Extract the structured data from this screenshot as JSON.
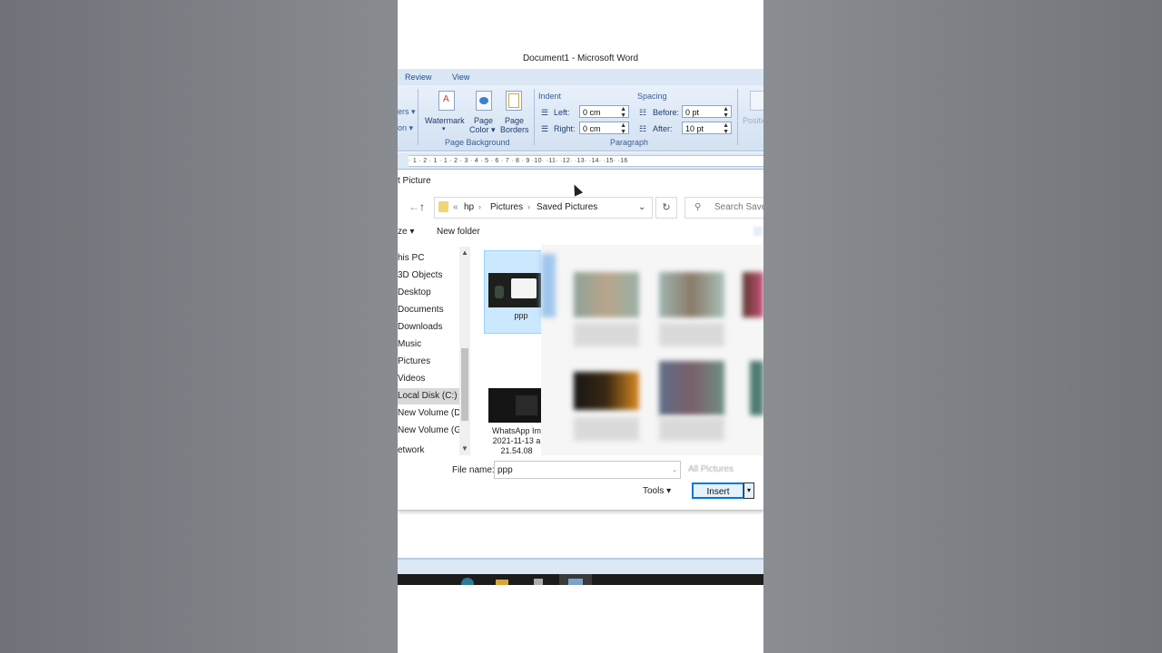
{
  "window": {
    "title": "Document1 - Microsoft Word"
  },
  "menu": {
    "items": [
      "Review",
      "View"
    ]
  },
  "ribbon": {
    "left_cut": [
      "ers ▾",
      "on ▾"
    ],
    "page_background": {
      "label": "Page Background",
      "buttons": [
        {
          "line1": "Watermark",
          "line2": "▾"
        },
        {
          "line1": "Page",
          "line2": "Color ▾"
        },
        {
          "line1": "Page",
          "line2": "Borders"
        }
      ]
    },
    "indent": {
      "label": "Indent",
      "left_label": "Left:",
      "left_value": "0 cm",
      "right_label": "Right:",
      "right_value": "0 cm"
    },
    "spacing": {
      "label": "Spacing",
      "before_label": "Before:",
      "before_value": "0 pt",
      "after_label": "After:",
      "after_value": "10 pt"
    },
    "paragraph_label": "Paragraph",
    "position_label": "Positio"
  },
  "ruler": {
    "text": "· 1 · 2 · 1 · 1 · 2 · 3 · 4 · 5 · 6 · 7 · 8 · 9 ·10· ·11· ·12· ·13· ·14· ·15· ·16"
  },
  "dialog": {
    "title": "t Picture",
    "path": {
      "prefix": "«",
      "crumbs": [
        "hp",
        "Pictures",
        "Saved Pictures"
      ]
    },
    "search_placeholder": "Search Saved",
    "organize": "ze ▾",
    "new_folder": "New folder",
    "nav_items": [
      {
        "label": "his PC",
        "selected": false
      },
      {
        "label": "3D Objects",
        "selected": false
      },
      {
        "label": "Desktop",
        "selected": false
      },
      {
        "label": "Documents",
        "selected": false
      },
      {
        "label": "Downloads",
        "selected": false
      },
      {
        "label": "Music",
        "selected": false
      },
      {
        "label": "Pictures",
        "selected": false
      },
      {
        "label": "Videos",
        "selected": false
      },
      {
        "label": "Local Disk (C:)",
        "selected": true
      },
      {
        "label": "New Volume (D:",
        "selected": false
      },
      {
        "label": "New Volume (G:",
        "selected": false
      },
      {
        "label": "etwork",
        "selected": false
      }
    ],
    "files": [
      {
        "name": "ppp"
      },
      {
        "name_lines": [
          "WhatsApp Im",
          "2021-11-13 a",
          "21.54.08"
        ]
      }
    ],
    "filename_label": "File name:",
    "filename_value": "ppp",
    "filter_value": "All Pictures",
    "tools": "Tools ▾",
    "insert": "Insert",
    "insert_drop": "▾"
  },
  "colors": {
    "accent": "#0078d7",
    "ribbon": "#dbe7f5",
    "selection": "#cce8ff"
  }
}
